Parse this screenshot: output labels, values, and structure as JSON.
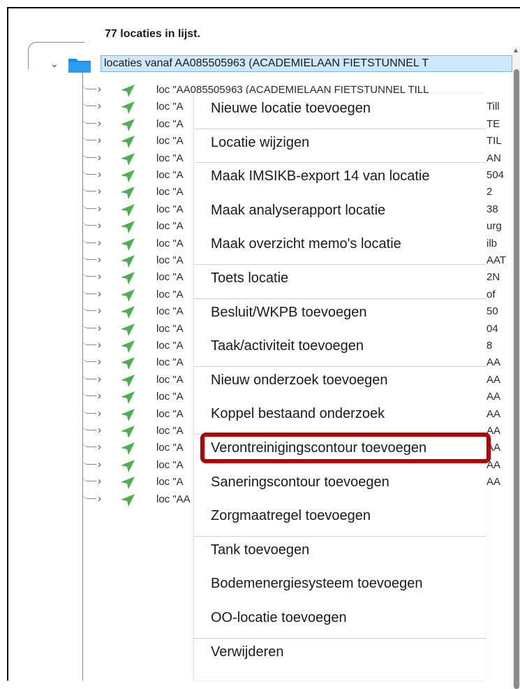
{
  "tree": {
    "count_label": "77 locaties in lijst.",
    "root_label": "locaties vanaf AA085505963 (ACADEMIELAAN FIETSTUNNEL T",
    "first_row_text": "loc \"AA085505963 (ACADEMIELAAN FIETSTUNNEL TILL",
    "row_prefix": "loc \"A",
    "last_row_text": "loc \"AA",
    "row_tails": [
      "Till",
      "TE",
      "TIL",
      "AN",
      "504",
      "2",
      "38",
      "urg",
      "ilb",
      "AAT",
      "2N",
      "of",
      "50",
      "04",
      "8",
      "AA",
      "AA",
      "AA",
      "AA",
      "AA",
      "AA",
      "AA",
      "AA"
    ]
  },
  "context_menu": {
    "items": [
      "Nieuwe locatie toevoegen",
      "Locatie wijzigen",
      "Maak IMSIKB-export 14 van locatie",
      "Maak analyserapport locatie",
      "Maak overzicht memo's locatie",
      "Toets locatie",
      "Besluit/WKPB toevoegen",
      "Taak/activiteit toevoegen",
      "Nieuw onderzoek toevoegen",
      "Koppel bestaand onderzoek",
      "Verontreinigingscontour toevoegen",
      "Saneringscontour toevoegen",
      "Zorgmaatregel toevoegen",
      "Tank toevoegen",
      "Bodemenergiesysteem toevoegen",
      "OO-locatie toevoegen",
      "Verwijderen"
    ],
    "highlighted_item": "Verontreinigingscontour toevoegen",
    "highlight_color": "#b40000"
  },
  "icons": {
    "root": "folder-icon",
    "row": "location-arrow-icon",
    "expander": "chevron-right-icon"
  },
  "colors": {
    "selection_bg": "#cde8ff",
    "selection_border": "#7fb2e5",
    "folder": "#1a8fe0",
    "location_icon": "#4caf50"
  }
}
